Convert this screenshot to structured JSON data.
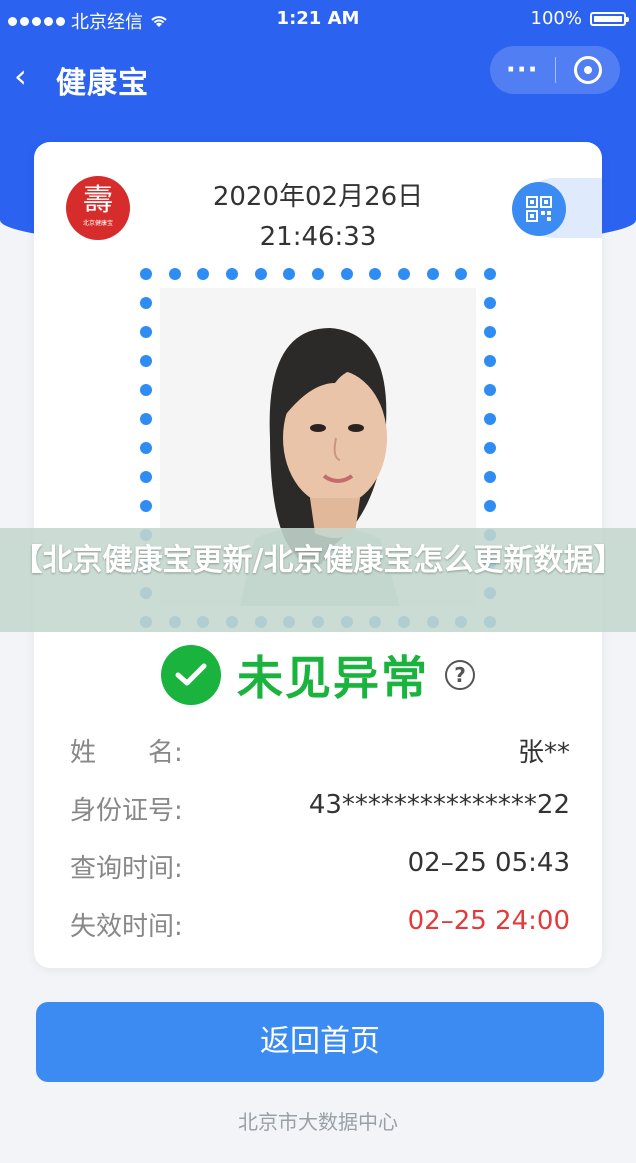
{
  "status_bar": {
    "carrier": "北京经信",
    "time": "1:21 AM",
    "battery": "100%"
  },
  "nav": {
    "back_icon": "‹",
    "title": "健康宝",
    "more": "···"
  },
  "card": {
    "logo_glyph": "壽",
    "logo_caption": "北京健康宝",
    "date": "2020年02月26日",
    "time": "21:46:33"
  },
  "health": {
    "status": "未见异常",
    "help": "?"
  },
  "info": [
    {
      "key": "姓　　名:",
      "value": "张**"
    },
    {
      "key": "身份证号:",
      "value": "43***************22"
    },
    {
      "key": "查询时间:",
      "value": "02–25 05:43"
    },
    {
      "key": "失效时间:",
      "value": "02–25 24:00"
    }
  ],
  "colors": {
    "brand": "#2b62f0",
    "button": "#3b8bf2",
    "ok": "#19b33d",
    "expire": "#e33b3b"
  },
  "home_button": "返回首页",
  "footer": "北京市大数据中心",
  "banner": "【北京健康宝更新/北京健康宝怎么更新数据】"
}
